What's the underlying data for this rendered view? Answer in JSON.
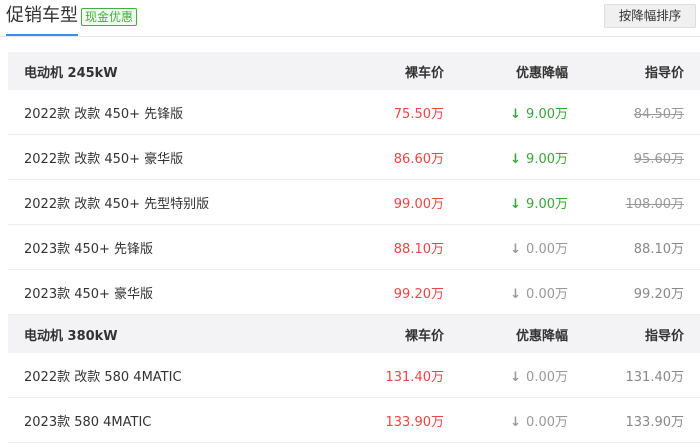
{
  "header": {
    "title": "促销车型",
    "badge": "现金优惠",
    "sort_button": "按降幅排序"
  },
  "colors": {
    "accent": "#3a8ee6",
    "price": "#e94646",
    "discount": "#3ba43b",
    "muted": "#999999"
  },
  "groups": [
    {
      "title": "电动机 245kW",
      "col_price": "裸车价",
      "col_discount": "优惠降幅",
      "col_guide": "指导价",
      "rows": [
        {
          "name": "2022款 改款 450+ 先锋版",
          "price": "75.50万",
          "discount": "9.00万",
          "guide": "84.50万",
          "has_discount": true
        },
        {
          "name": "2022款 改款 450+ 豪华版",
          "price": "86.60万",
          "discount": "9.00万",
          "guide": "95.60万",
          "has_discount": true
        },
        {
          "name": "2022款 改款 450+ 先型特别版",
          "price": "99.00万",
          "discount": "9.00万",
          "guide": "108.00万",
          "has_discount": true
        },
        {
          "name": "2023款 450+ 先锋版",
          "price": "88.10万",
          "discount": "0.00万",
          "guide": "88.10万",
          "has_discount": false
        },
        {
          "name": "2023款 450+ 豪华版",
          "price": "99.20万",
          "discount": "0.00万",
          "guide": "99.20万",
          "has_discount": false
        }
      ]
    },
    {
      "title": "电动机 380kW",
      "col_price": "裸车价",
      "col_discount": "优惠降幅",
      "col_guide": "指导价",
      "rows": [
        {
          "name": "2022款 改款 580 4MATIC",
          "price": "131.40万",
          "discount": "0.00万",
          "guide": "131.40万",
          "has_discount": false
        },
        {
          "name": "2023款 580 4MATIC",
          "price": "133.90万",
          "discount": "0.00万",
          "guide": "133.90万",
          "has_discount": false
        }
      ]
    }
  ]
}
